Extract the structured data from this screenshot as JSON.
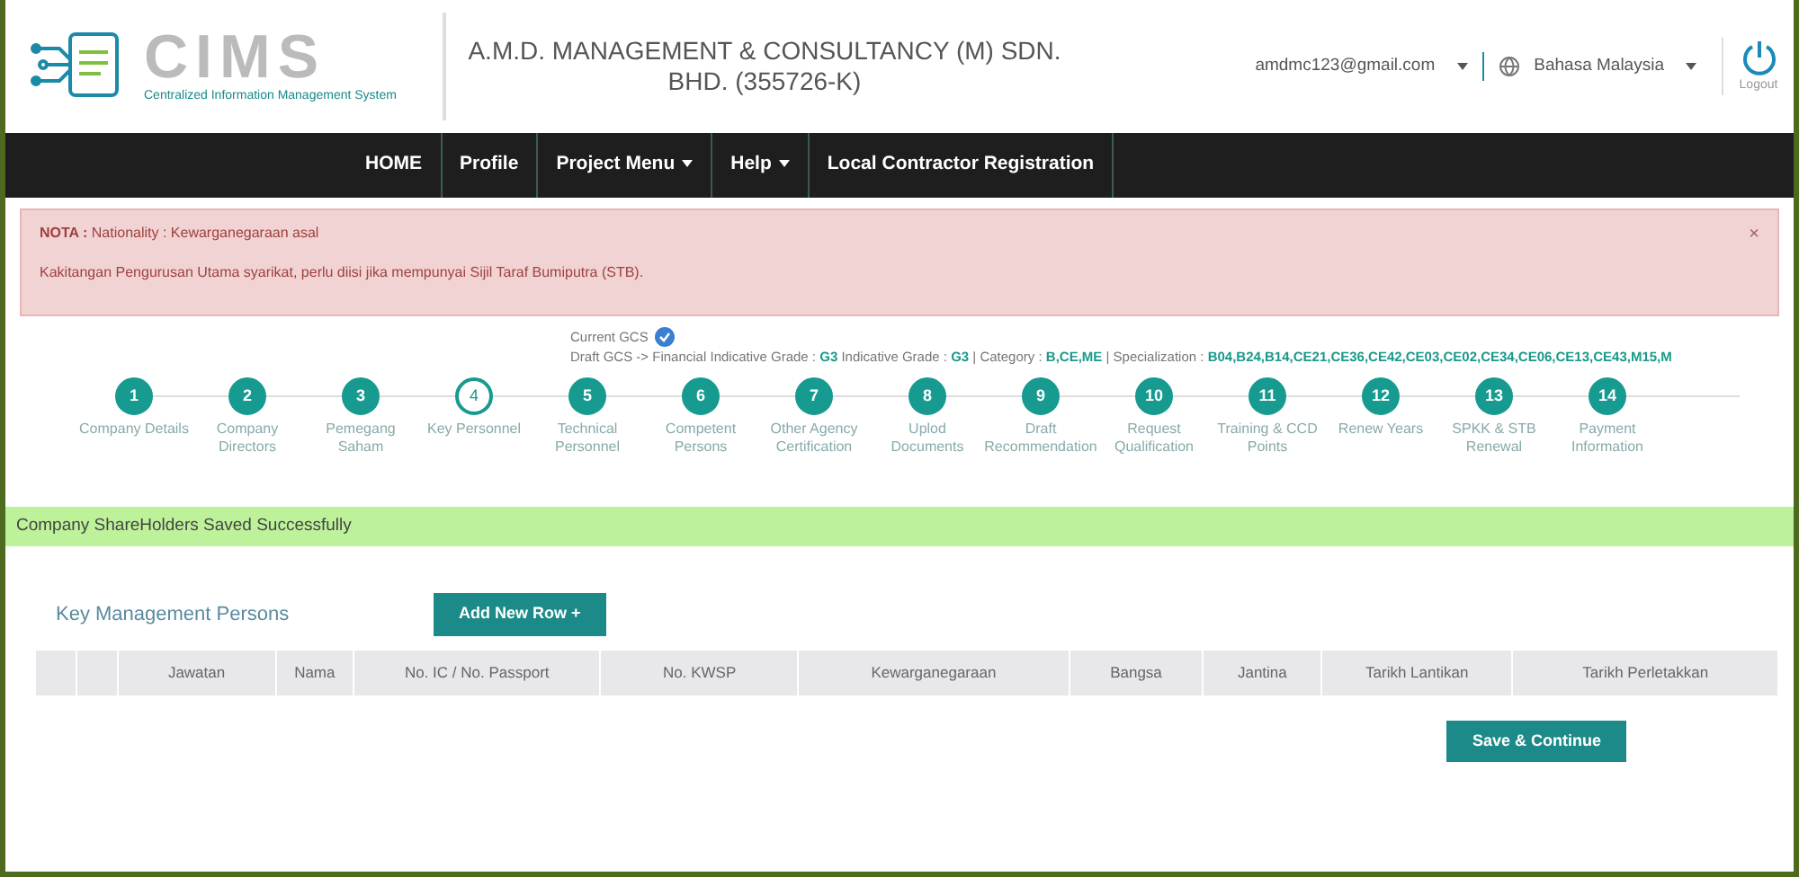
{
  "header": {
    "logo_text": "CIMS",
    "logo_tagline": "Centralized Information Management System",
    "company": "A.M.D. MANAGEMENT & CONSULTANCY (M) SDN. BHD. (355726-K)",
    "user_email": "amdmc123@gmail.com",
    "language": "Bahasa Malaysia",
    "logout": "Logout"
  },
  "nav": [
    {
      "label": "HOME",
      "dropdown": false
    },
    {
      "label": "Profile",
      "dropdown": false
    },
    {
      "label": "Project Menu",
      "dropdown": true
    },
    {
      "label": "Help",
      "dropdown": true
    },
    {
      "label": "Local Contractor Registration",
      "dropdown": false
    }
  ],
  "alert": {
    "line_1": "**NOTA :** Nationality : Kewarganegaraan asal",
    "line_2": "Kakitangan Pengurusan Utama syarikat, perlu diisi jika mempunyai Sijil Taraf Bumiputra (STB).",
    "close": "×"
  },
  "gcs": {
    "current": "Current GCS",
    "draft": "Draft GCS -> Financial Indicative Grade : **G3**  Indicative Grade : **G3** | Category : **B,CE,ME** | Specialization : **B04,B24,B14,CE21,CE36,CE42,CE03,CE02,CE34,CE06,CE13,CE43,M15,M**"
  },
  "steps": [
    {
      "number": "1",
      "label": "Company Details",
      "selected": false
    },
    {
      "number": "2",
      "label": "Company Directors",
      "selected": false
    },
    {
      "number": "3",
      "label": "Pemegang Saham",
      "selected": false
    },
    {
      "number": "4",
      "label": "Key Personnel",
      "selected": true
    },
    {
      "number": "5",
      "label": "Technical Personnel",
      "selected": false
    },
    {
      "number": "6",
      "label": "Competent Persons",
      "selected": false
    },
    {
      "number": "7",
      "label": "Other Agency Certification",
      "selected": false
    },
    {
      "number": "8",
      "label": "Uplod Documents",
      "selected": false
    },
    {
      "number": "9",
      "label": "Draft Recommendation",
      "selected": false
    },
    {
      "number": "10",
      "label": "Request Qualification",
      "selected": false
    },
    {
      "number": "11",
      "label": "Training & CCD Points",
      "selected": false
    },
    {
      "number": "12",
      "label": "Renew Years",
      "selected": false
    },
    {
      "number": "13",
      "label": "SPKK & STB Renewal",
      "selected": false
    },
    {
      "number": "14",
      "label": "Payment Information",
      "selected": false
    }
  ],
  "success_message": "Company ShareHolders Saved Successfully",
  "section_title": "Key Management Persons",
  "add_row_button": "Add New Row +",
  "table": {
    "columns": [
      "Jawatan",
      "Nama",
      "No. IC / No. Passport",
      "No. KWSP",
      "Kewarganegaraan",
      "Bangsa",
      "Jantina",
      "Tarikh Lantikan",
      "Tarikh Perletakkan"
    ]
  },
  "save_button": "Save & Continue"
}
